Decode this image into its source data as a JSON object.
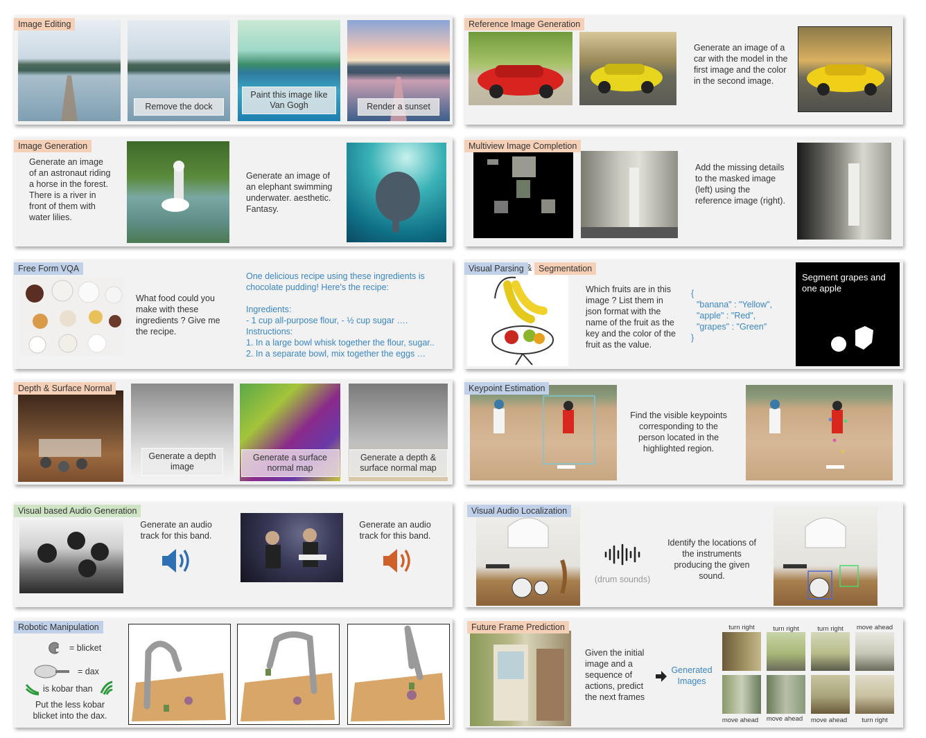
{
  "image_editing": {
    "tag": "Image Editing",
    "captions": [
      "Remove the dock",
      "Paint this image like Van Gogh",
      "Render a sunset"
    ]
  },
  "reference_generation": {
    "tag": "Reference Image Generation",
    "prompt": "Generate an image of a car with the model in the first image and the color in the second image."
  },
  "image_generation": {
    "tag": "Image Generation",
    "prompt1": "Generate an image of an astronaut riding a horse in the forest. There is a river in front of them with water lilies.",
    "prompt2": "Generate an image of an elephant swimming underwater. aesthetic. Fantasy."
  },
  "multiview": {
    "tag": "Multiview Image Completion",
    "prompt": "Add the missing details to the masked image (left) using the reference image (right)."
  },
  "vqa": {
    "tag": "Free Form VQA",
    "question": "What food could you make with these ingredients ? Give me the recipe.",
    "answer_lines": [
      "One delicious recipe using these ingredients is",
      "chocolate pudding! Here's the recipe:",
      "",
      "Ingredients:",
      "- 1 cup all-purpose flour, - ½ cup sugar ….",
      "Instructions:",
      "1. In a large bowl whisk together the flour, sugar..",
      "2. In a separate bowl, mix together the eggs …"
    ]
  },
  "parsing": {
    "tag1": "Visual Parsing",
    "amp": "&",
    "tag2": "Segmentation",
    "question": "Which fruits are in this image ? List them in json format with the name of the fruit as the key and the color of the fruit as the value.",
    "json_lines": [
      "{",
      "\"banana\" : \"Yellow\",",
      "\"apple\" : \"Red\",",
      "\"grapes\" : \"Green\"",
      "}"
    ],
    "seg_prompt": "Segment grapes and one apple"
  },
  "depth": {
    "tag": "Depth & Surface Normal",
    "captions": [
      "Generate a depth image",
      "Generate a surface normal map",
      "Generate a depth & surface normal map"
    ]
  },
  "keypoint": {
    "tag": "Keypoint Estimation",
    "prompt": "Find the visible keypoints corresponding to the person located in the highlighted region."
  },
  "audio_gen": {
    "tag": "Visual based Audio Generation",
    "prompt1": "Generate an audio track for this band.",
    "prompt2": "Generate an audio track for this band.",
    "color1": "#2f6fb3",
    "color2": "#d0602a"
  },
  "audio_loc": {
    "tag": "Visual Audio Localization",
    "sound_label": "(drum sounds)",
    "prompt": "Identify the locations of the instruments producing the given sound."
  },
  "robotic": {
    "tag": "Robotic Manipulation",
    "blicket": "= blicket",
    "dax": "= dax",
    "kobar": "is kobar than",
    "instruction": "Put the less kobar blicket into the dax."
  },
  "future": {
    "tag": "Future Frame Prediction",
    "prompt": "Given the initial image and a sequence of actions, predict the next frames",
    "generated": "Generated Images",
    "top_labels": [
      "turn right",
      "turn right",
      "turn right",
      "move ahead"
    ],
    "bottom_labels": [
      "move ahead",
      "move ahead",
      "move ahead",
      "turn right"
    ]
  }
}
